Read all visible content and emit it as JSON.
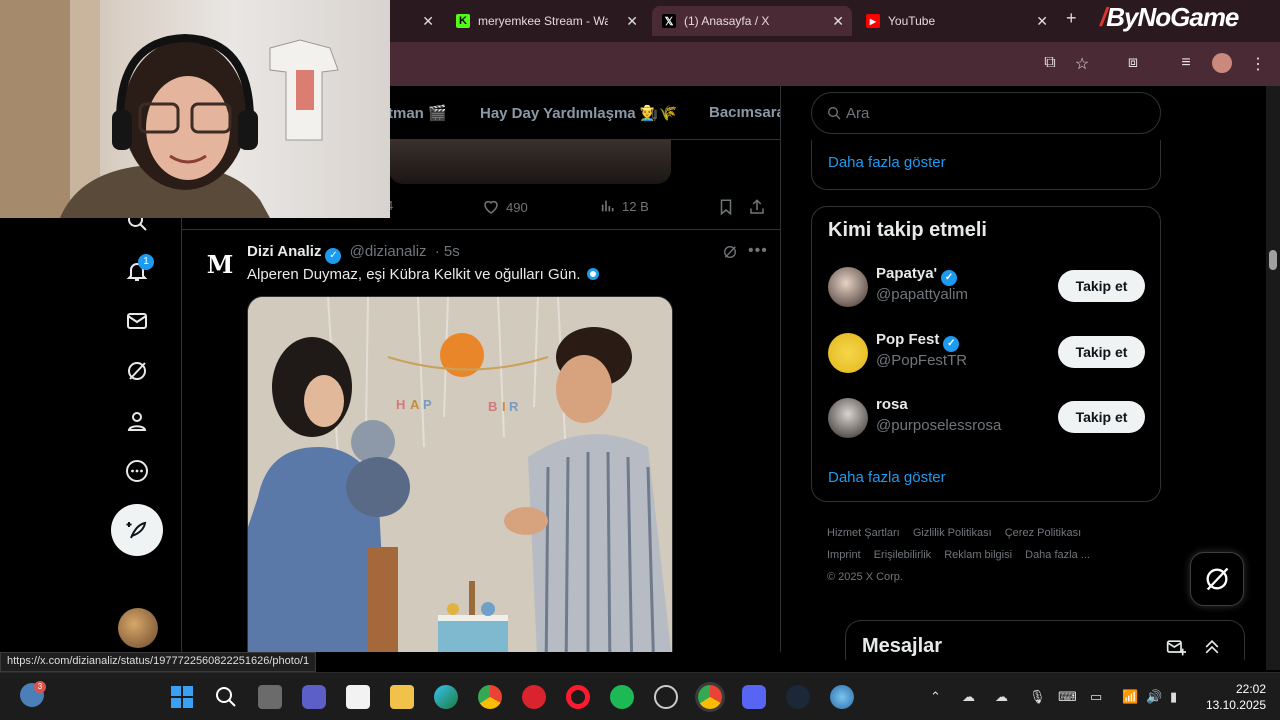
{
  "browser": {
    "tabs": [
      {
        "title": "",
        "active": false
      },
      {
        "title": "meryemkee Stream - Wa",
        "active": false
      },
      {
        "title": "(1) Anasayfa / X",
        "active": true
      },
      {
        "title": "YouTube",
        "active": false
      }
    ],
    "brand": "ByNoGame",
    "status_url": "https://x.com/dizianaliz/status/1977722560822251626/photo/1"
  },
  "nav": {
    "notification_count": "1"
  },
  "topics": [
    "tman 🎬",
    "Hay Day Yardımlaşma 👨‍🌾🌾",
    "Bacımsara"
  ],
  "prev_post": {
    "likes": "490",
    "views": "12 B",
    "replies_partial": "4"
  },
  "tweet": {
    "name": "Dizi Analiz",
    "handle": "@dizianaliz",
    "time": "· 5s",
    "text": "Alperen Duymaz, eşi Kübra Kelkit ve oğulları Gün.",
    "avatar_letter": "M"
  },
  "sidebar": {
    "search_placeholder": "Ara",
    "show_more_top": "Daha fazla göster",
    "who_to_follow_title": "Kimi takip etmeli",
    "suggestions": [
      {
        "name": "Papatya'",
        "handle": "@papattyalim",
        "verified": true,
        "button": "Takip et"
      },
      {
        "name": "Pop Fest",
        "handle": "@PopFestTR",
        "verified": true,
        "button": "Takip et"
      },
      {
        "name": "rosa",
        "handle": "@purposelessrosa",
        "verified": false,
        "button": "Takip et"
      }
    ],
    "show_more_bottom": "Daha fazla göster",
    "footer_links": [
      "Hizmet Şartları",
      "Gizlilik Politikası",
      "Çerez Politikası",
      "Imprint",
      "Erişilebilirlik",
      "Reklam bilgisi",
      "Daha fazla ..."
    ],
    "copyright": "© 2025 X Corp."
  },
  "messages": {
    "title": "Mesajlar"
  },
  "taskbar": {
    "weather_badge": "3",
    "time": "22:02",
    "date": "13.10.2025"
  },
  "colors": {
    "accent": "#1d9bf0",
    "tab_bg": "#2a1a20",
    "toolbar_bg": "#4a2b35"
  }
}
